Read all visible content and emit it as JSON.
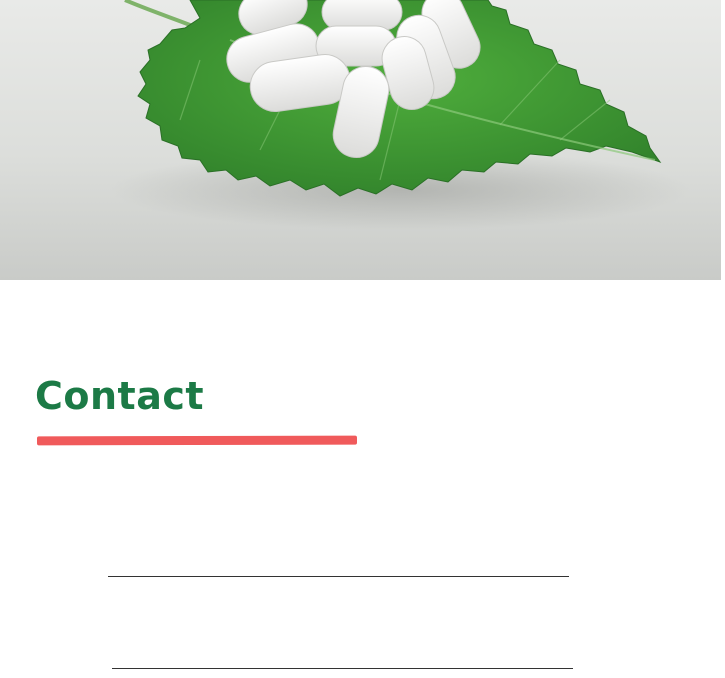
{
  "contact": {
    "heading": "Contact"
  },
  "colors": {
    "heading": "#1c7a46",
    "accent_bar": "#f05a5b",
    "leaf": "#3f9a34",
    "pill": "#f4f4f2"
  },
  "form": {
    "fields": [
      {
        "value": ""
      },
      {
        "value": ""
      }
    ]
  }
}
